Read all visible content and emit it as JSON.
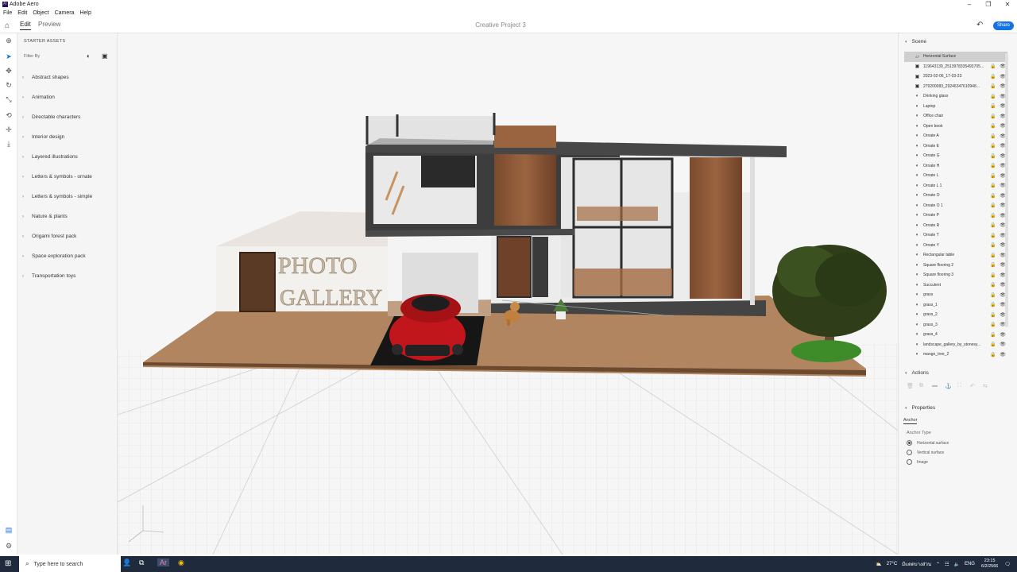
{
  "app": {
    "title": "Adobe Aero",
    "logo_text": "Ar"
  },
  "window_controls": {
    "minimize": "–",
    "maximize": "❐",
    "close": "✕"
  },
  "menu": [
    "File",
    "Edit",
    "Object",
    "Camera",
    "Help"
  ],
  "toolbar": {
    "tabs": [
      "Edit",
      "Preview"
    ],
    "active_tab": "Edit",
    "project_title": "Creative Project 3",
    "share_label": "Share"
  },
  "assets": {
    "header": "STARTER ASSETS",
    "filter_label": "Filter By",
    "categories": [
      "Abstract shapes",
      "Animation",
      "Directable characters",
      "Interior design",
      "Layered illustrations",
      "Letters & symbols - ornate",
      "Letters & symbols - simple",
      "Nature & plants",
      "Origami forest pack",
      "Space exploration pack",
      "Transportation toys"
    ]
  },
  "viewport": {
    "sign_line1": "PHOTO",
    "sign_line2": "GALLERY",
    "accent_wood": "#8a5a3a",
    "floor_color": "#b08560",
    "car_color": "#c0161c"
  },
  "scene": {
    "title": "Scene",
    "layers": [
      {
        "name": "Horizontal Surface",
        "icon": "surface-icon",
        "selected": true
      },
      {
        "name": "119643139_2513978335493705...",
        "icon": "image-icon"
      },
      {
        "name": "2023-02-06_17-03-23",
        "icon": "image-icon"
      },
      {
        "name": "279200083_29246347610948...",
        "icon": "image-icon"
      },
      {
        "name": "Drinking glass",
        "icon": "model-icon"
      },
      {
        "name": "Laptop",
        "icon": "model-icon"
      },
      {
        "name": "Office chair",
        "icon": "model-icon"
      },
      {
        "name": "Open book",
        "icon": "model-icon"
      },
      {
        "name": "Ornate A",
        "icon": "model-icon"
      },
      {
        "name": "Ornate E",
        "icon": "model-icon"
      },
      {
        "name": "Ornate G",
        "icon": "model-icon"
      },
      {
        "name": "Ornate H",
        "icon": "model-icon"
      },
      {
        "name": "Ornate L",
        "icon": "model-icon"
      },
      {
        "name": "Ornate L 1",
        "icon": "model-icon"
      },
      {
        "name": "Ornate O",
        "icon": "model-icon"
      },
      {
        "name": "Ornate O 1",
        "icon": "model-icon"
      },
      {
        "name": "Ornate P",
        "icon": "model-icon"
      },
      {
        "name": "Ornate R",
        "icon": "model-icon"
      },
      {
        "name": "Ornate T",
        "icon": "model-icon"
      },
      {
        "name": "Ornate Y",
        "icon": "model-icon"
      },
      {
        "name": "Rectangular table",
        "icon": "model-icon"
      },
      {
        "name": "Square flooring 2",
        "icon": "model-icon"
      },
      {
        "name": "Square flooring 3",
        "icon": "model-icon"
      },
      {
        "name": "Succulent",
        "icon": "model-icon"
      },
      {
        "name": "grass",
        "icon": "model-icon"
      },
      {
        "name": "grass_1",
        "icon": "model-icon"
      },
      {
        "name": "grass_2",
        "icon": "model-icon"
      },
      {
        "name": "grass_3",
        "icon": "model-icon"
      },
      {
        "name": "grass_4",
        "icon": "model-icon"
      },
      {
        "name": "landscape_gallery_by_stonesy...",
        "icon": "model-icon"
      },
      {
        "name": "mango_tree_2",
        "icon": "model-icon"
      }
    ]
  },
  "actions": {
    "title": "Actions"
  },
  "properties": {
    "title": "Properties",
    "tab": "Anchor",
    "anchor_type_label": "Anchor Type",
    "options": [
      {
        "label": "Horizontal surface",
        "selected": true
      },
      {
        "label": "Vertical surface",
        "selected": false
      },
      {
        "label": "Image",
        "selected": false
      }
    ]
  },
  "taskbar": {
    "search_placeholder": "Type here to search",
    "weather": "27°C",
    "weather_text": "มีแดดบางส่วน",
    "lang": "ENG",
    "time": "23:15",
    "date": "6/2/2566"
  }
}
